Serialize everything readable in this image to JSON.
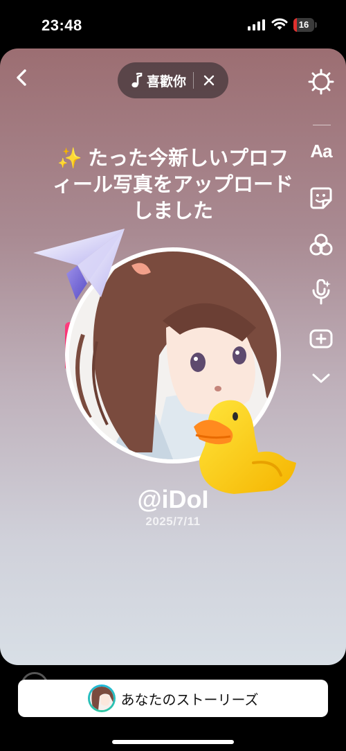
{
  "status_bar": {
    "time": "23:48",
    "battery": "16"
  },
  "music": {
    "title": "喜歡你"
  },
  "tools": {
    "text_tool_label": "Aa"
  },
  "post": {
    "sparkle": "✨",
    "headline": "たった今新しいプロフィール写真をアップロードしました",
    "username": "@iDoI",
    "date": "2025/7/11"
  },
  "footer": {
    "your_story_label": "あなたのストーリーズ"
  },
  "colors": {
    "bg": "#000000",
    "battery_low": "#e0302e",
    "ring": "#1fb6d9"
  },
  "icons": [
    "back-chevron-icon",
    "music-note-icon",
    "close-icon",
    "settings-gear-icon",
    "sticker-icon",
    "effects-icon",
    "voice-sparkle-mic-icon",
    "add-layer-icon",
    "chevron-down-icon",
    "paper-plane-icon",
    "duck-sticker-icon"
  ]
}
